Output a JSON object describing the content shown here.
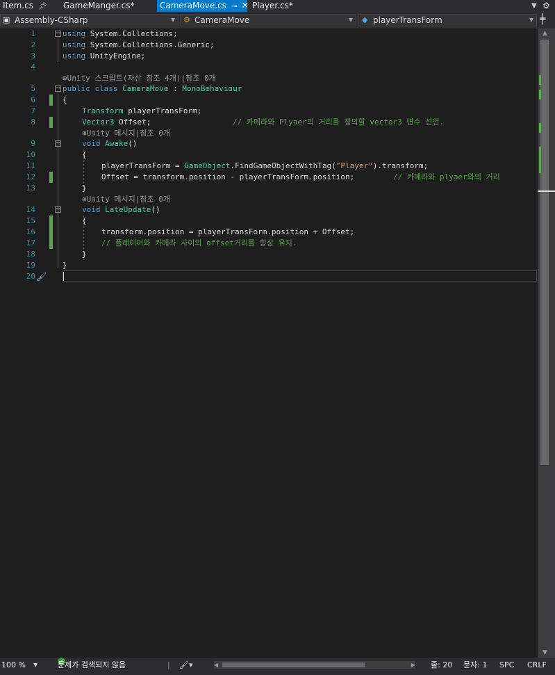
{
  "tabs": [
    {
      "label": "Item.cs",
      "pinned": true
    },
    {
      "label": "GameManger.cs*"
    },
    {
      "label": "CameraMove.cs",
      "active": true,
      "pinned": true,
      "closable": true
    },
    {
      "label": "Player.cs*"
    }
  ],
  "nav": {
    "project": "Assembly-CSharp",
    "type": "CameraMove",
    "member": "playerTransForm"
  },
  "editor": {
    "line_numbers": [
      "1",
      "2",
      "3",
      "4",
      "5",
      "6",
      "7",
      "8",
      "9",
      "10",
      "11",
      "12",
      "13",
      "14",
      "15",
      "16",
      "17",
      "18",
      "19",
      "20"
    ],
    "code_lens": [
      "Unity 스크립트(자산 참조 4개)|참조 0개",
      "Unity 메시지|참조 0개",
      "Unity 메시지|참조 0개"
    ],
    "lines": {
      "l1": [
        "using",
        " System.Collections;"
      ],
      "l2": [
        "using",
        " System.Collections.Generic;"
      ],
      "l3": [
        "using",
        " UnityEngine;"
      ],
      "l5": [
        "public",
        " ",
        "class",
        " ",
        "CameraMove",
        " : ",
        "MonoBehaviour"
      ],
      "l6": "{",
      "l7": [
        "Transform",
        " playerTransForm;"
      ],
      "l8": [
        "Vector3",
        " Offset;",
        "// 카메라와 Plyaer의 거리를 정의할 vector3 변수 선언."
      ],
      "l9": [
        "void",
        " ",
        "Awake",
        "()"
      ],
      "l10": "{",
      "l11": [
        "playerTransForm = ",
        "GameObject",
        ".FindGameObjectWithTag(",
        "\"Player\"",
        ").transform;"
      ],
      "l12": [
        "Offset = transform.position - playerTransForm.position;",
        "// 카메라와 plyaer와의 거리"
      ],
      "l13": "}",
      "l14": [
        "void",
        " ",
        "LateUpdate",
        "()"
      ],
      "l15": "{",
      "l16": "transform.position = playerTransForm.position + Offset;",
      "l17": "// 플레이어와 카메라 사이의 offset거리를 항상 유지.",
      "l18": "}",
      "l19": "}"
    }
  },
  "status": {
    "zoom": "100 %",
    "issues": "문제가 검색되지 않음",
    "line": "줄: 20",
    "char": "문자: 1",
    "spc": "SPC",
    "crlf": "CRLF"
  },
  "colors": {
    "keyword": "#569cd6",
    "type": "#4ec9b0",
    "string": "#d69d85",
    "comment": "#57a64a",
    "line_number": "#2b91af",
    "accent": "#007acc"
  }
}
